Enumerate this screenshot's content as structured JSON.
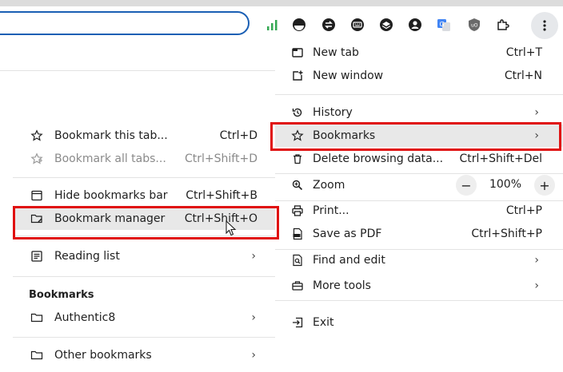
{
  "main_menu": {
    "new_tab": {
      "label": "New tab",
      "shortcut": "Ctrl+T"
    },
    "new_window": {
      "label": "New window",
      "shortcut": "Ctrl+N"
    },
    "history": {
      "label": "History"
    },
    "bookmarks": {
      "label": "Bookmarks"
    },
    "delete_browsing_data": {
      "label": "Delete browsing data...",
      "shortcut": "Ctrl+Shift+Del"
    },
    "zoom": {
      "label": "Zoom",
      "minus": "−",
      "value": "100%",
      "plus": "+"
    },
    "print": {
      "label": "Print...",
      "shortcut": "Ctrl+P"
    },
    "save_pdf": {
      "label": "Save as PDF",
      "shortcut": "Ctrl+Shift+P"
    },
    "find_edit": {
      "label": "Find and edit"
    },
    "more_tools": {
      "label": "More tools"
    },
    "exit": {
      "label": "Exit"
    }
  },
  "bookmarks_menu": {
    "bookmark_tab": {
      "label": "Bookmark this tab...",
      "shortcut": "Ctrl+D"
    },
    "bookmark_all": {
      "label": "Bookmark all tabs...",
      "shortcut": "Ctrl+Shift+D"
    },
    "hide_bar": {
      "label": "Hide bookmarks bar",
      "shortcut": "Ctrl+Shift+B"
    },
    "manager": {
      "label": "Bookmark manager",
      "shortcut": "Ctrl+Shift+O"
    },
    "reading_list": {
      "label": "Reading list"
    },
    "section_heading": "Bookmarks",
    "folders": [
      {
        "label": "Authentic8"
      },
      {
        "label": "Other bookmarks"
      }
    ]
  },
  "chevron": "›",
  "colors": {
    "highlight_border": "#e01010",
    "signal_green": "#34a853",
    "omnibox_border": "#1a5fb4"
  }
}
